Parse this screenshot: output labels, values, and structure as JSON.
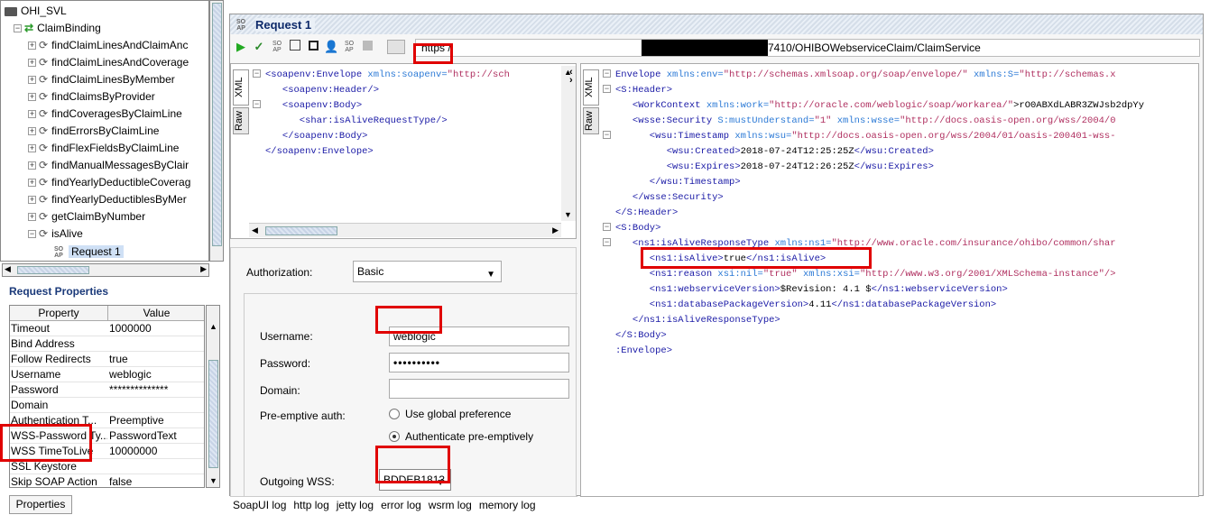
{
  "tree": {
    "root": "OHI_SVL",
    "binding": "ClaimBinding",
    "operations": [
      "findClaimLinesAndClaimAnc",
      "findClaimLinesAndCoverage",
      "findClaimLinesByMember",
      "findClaimsByProvider",
      "findCoveragesByClaimLine",
      "findErrorsByClaimLine",
      "findFlexFieldsByClaimLine",
      "findManualMessagesByClair",
      "findYearlyDeductibleCoverag",
      "findYearlyDeductiblesByMer",
      "getClaimByNumber",
      "isAlive"
    ],
    "request": "Request 1"
  },
  "properties": {
    "title": "Request Properties",
    "col_property": "Property",
    "col_value": "Value",
    "rows": [
      {
        "name": "Timeout",
        "value": "1000000"
      },
      {
        "name": "Bind Address",
        "value": ""
      },
      {
        "name": "Follow Redirects",
        "value": "true"
      },
      {
        "name": "Username",
        "value": "weblogic"
      },
      {
        "name": "Password",
        "value": "**************"
      },
      {
        "name": "Domain",
        "value": ""
      },
      {
        "name": "Authentication T...",
        "value": "Preemptive"
      },
      {
        "name": "WSS-Password Ty...",
        "value": "PasswordText"
      },
      {
        "name": "WSS TimeToLive",
        "value": "10000000"
      },
      {
        "name": "SSL Keystore",
        "value": ""
      },
      {
        "name": "Skip SOAP Action",
        "value": "false"
      }
    ],
    "button": "Properties"
  },
  "request": {
    "title": "Request 1",
    "url_scheme": "https",
    "url_tail": "7410/OHIBOWebserviceClaim/ClaimService",
    "tab_xml": "XML",
    "tab_raw": "Raw",
    "xml": [
      {
        "open": "<soapenv:Envelope ",
        "attr": "xmlns:soapenv=",
        "val": "\"http://sch",
        "close": ""
      },
      {
        "open": "   <soapenv:Header/>",
        "attr": "",
        "val": "",
        "close": ""
      },
      {
        "open": "   <soapenv:Body>",
        "attr": "",
        "val": "",
        "close": ""
      },
      {
        "open": "      <shar:isAliveRequestType/>",
        "attr": "",
        "val": "",
        "close": ""
      },
      {
        "open": "   </soapenv:Body>",
        "attr": "",
        "val": "",
        "close": ""
      },
      {
        "open": "</soapenv:Envelope>",
        "attr": "",
        "val": "",
        "close": ""
      }
    ]
  },
  "auth": {
    "authorization_label": "Authorization:",
    "authorization_value": "Basic",
    "username_label": "Username:",
    "username_value": "weblogic",
    "password_label": "Password:",
    "password_value": "••••••••••",
    "domain_label": "Domain:",
    "preemptive_label": "Pre-emptive auth:",
    "radio_global": "Use global preference",
    "radio_preemptive": "Authenticate pre-emptively",
    "outgoing_wss_label": "Outgoing WSS:",
    "outgoing_wss_value": "BDDEB1813"
  },
  "response": {
    "tab_xml": "XML",
    "tab_raw": "Raw",
    "lines": [
      {
        "t": "Envelope ",
        "a": "xmlns:env=",
        "v": "\"http://schemas.xmlsoap.org/soap/envelope/\"",
        "a2": " xmlns:S=",
        "v2": "\"http://schemas.x",
        "x": "",
        "c": ""
      },
      {
        "t": "<S:Header>",
        "a": "",
        "v": "",
        "a2": "",
        "v2": "",
        "x": "",
        "c": ""
      },
      {
        "t": "   <WorkContext ",
        "a": "xmlns:work=",
        "v": "\"http://oracle.com/weblogic/soap/workarea/\"",
        "a2": "",
        "v2": "",
        "x": ">rO0ABXdLABR3ZWJsb2dpYy",
        "c": ""
      },
      {
        "t": "   <wsse:Security ",
        "a": "S:mustUnderstand=",
        "v": "\"1\"",
        "a2": " xmlns:wsse=",
        "v2": "\"http://docs.oasis-open.org/wss/2004/0",
        "x": "",
        "c": ""
      },
      {
        "t": "      <wsu:Timestamp ",
        "a": "xmlns:wsu=",
        "v": "\"http://docs.oasis-open.org/wss/2004/01/oasis-200401-wss-",
        "a2": "",
        "v2": "",
        "x": "",
        "c": ""
      },
      {
        "t": "         <wsu:Created>",
        "a": "",
        "v": "",
        "a2": "",
        "v2": "",
        "x": "2018-07-24T12:25:25Z",
        "c": "</wsu:Created>"
      },
      {
        "t": "         <wsu:Expires>",
        "a": "",
        "v": "",
        "a2": "",
        "v2": "",
        "x": "2018-07-24T12:26:25Z",
        "c": "</wsu:Expires>"
      },
      {
        "t": "      </wsu:Timestamp>",
        "a": "",
        "v": "",
        "a2": "",
        "v2": "",
        "x": "",
        "c": ""
      },
      {
        "t": "   </wsse:Security>",
        "a": "",
        "v": "",
        "a2": "",
        "v2": "",
        "x": "",
        "c": ""
      },
      {
        "t": "</S:Header>",
        "a": "",
        "v": "",
        "a2": "",
        "v2": "",
        "x": "",
        "c": ""
      },
      {
        "t": "<S:Body>",
        "a": "",
        "v": "",
        "a2": "",
        "v2": "",
        "x": "",
        "c": ""
      },
      {
        "t": "   <ns1:isAliveResponseType ",
        "a": "xmlns:ns1=",
        "v": "\"http://www.oracle.com/insurance/ohibo/common/shar",
        "a2": "",
        "v2": "",
        "x": "",
        "c": ""
      },
      {
        "t": "      <ns1:isAlive>",
        "a": "",
        "v": "",
        "a2": "",
        "v2": "",
        "x": "true",
        "c": "</ns1:isAlive>"
      },
      {
        "t": "      <ns1:reason ",
        "a": "xsi:nil=",
        "v": "\"true\"",
        "a2": " xmlns:xsi=",
        "v2": "\"http://www.w3.org/2001/XMLSchema-instance\"/>",
        "x": "",
        "c": ""
      },
      {
        "t": "      <ns1:webserviceVersion>",
        "a": "",
        "v": "",
        "a2": "",
        "v2": "",
        "x": "$Revision: 4.1 $",
        "c": "</ns1:webserviceVersion>"
      },
      {
        "t": "      <ns1:databasePackageVersion>",
        "a": "",
        "v": "",
        "a2": "",
        "v2": "",
        "x": "4.11",
        "c": "</ns1:databasePackageVersion>"
      },
      {
        "t": "   </ns1:isAliveResponseType>",
        "a": "",
        "v": "",
        "a2": "",
        "v2": "",
        "x": "",
        "c": ""
      },
      {
        "t": "</S:Body>",
        "a": "",
        "v": "",
        "a2": "",
        "v2": "",
        "x": "",
        "c": ""
      },
      {
        "t": ":Envelope>",
        "a": "",
        "v": "",
        "a2": "",
        "v2": "",
        "x": "",
        "c": ""
      }
    ]
  },
  "logs": [
    "SoapUI log",
    "http log",
    "jetty log",
    "error log",
    "wsrm log",
    "memory log"
  ],
  "colors": {
    "highlight": "#e00000",
    "title": "#0e2a6a",
    "tag": "#1a1aa6",
    "attr": "#2c7ad6",
    "value": "#b03060"
  }
}
